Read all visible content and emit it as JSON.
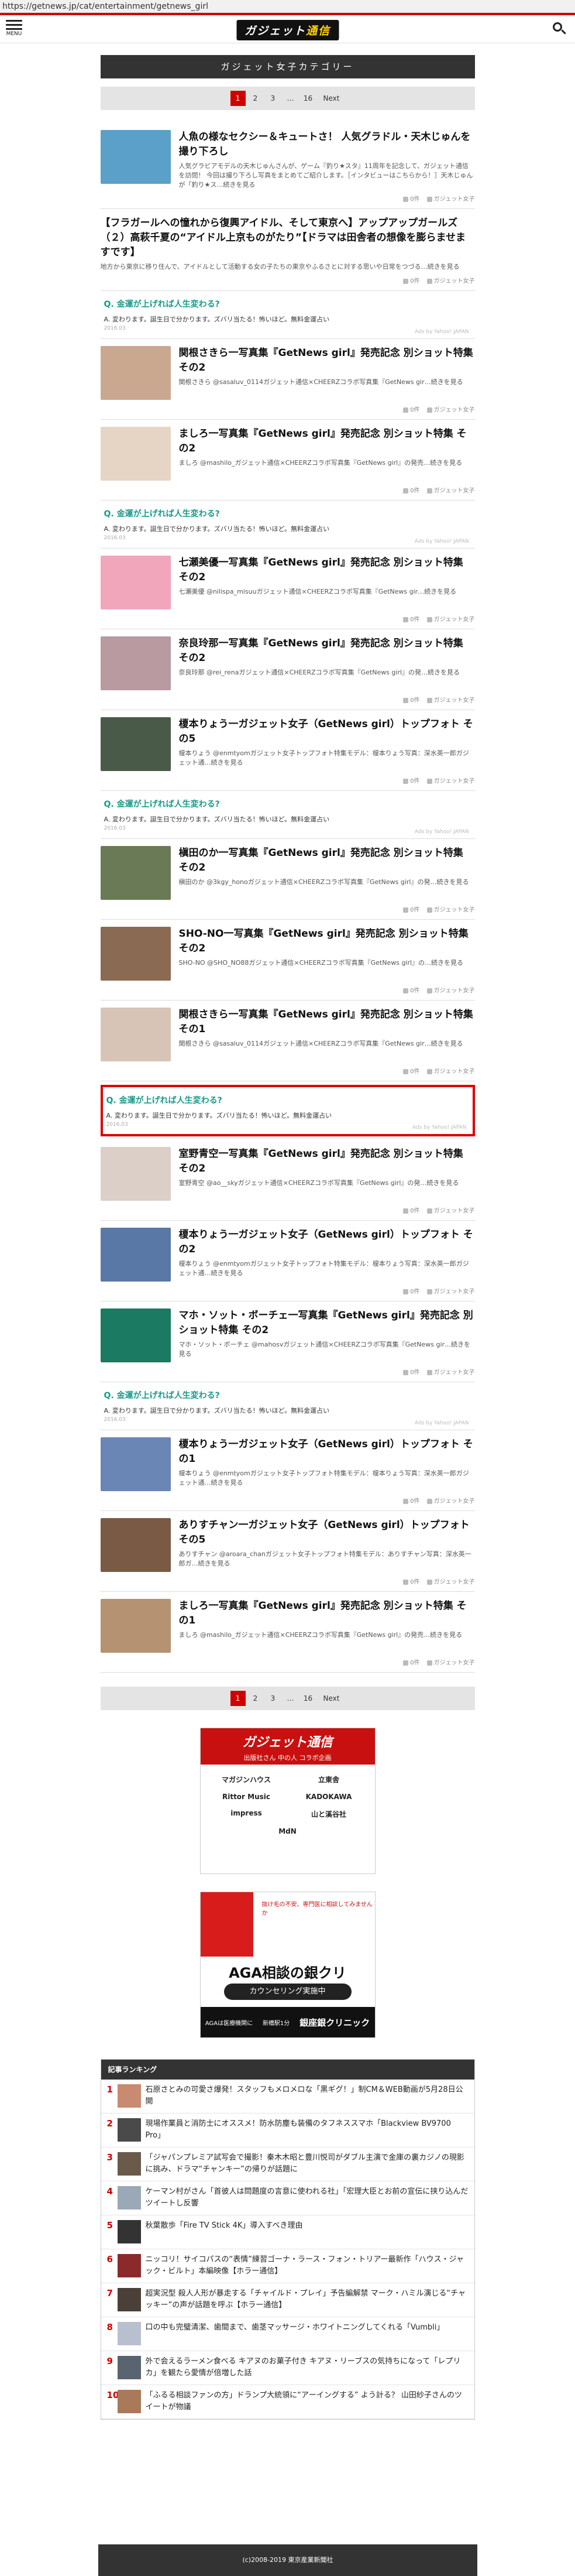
{
  "url": "https://getnews.jp/cat/entertainment/getnews_girl",
  "header": {
    "menu_label": "MENU",
    "logo_a": "ガジェット",
    "logo_b": "通信"
  },
  "category_title": "ガジェット女子カテゴリー",
  "pager": {
    "current": "1",
    "p2": "2",
    "p3": "3",
    "dots": "…",
    "last": "16",
    "next": "Next"
  },
  "ad": {
    "q": "Q. 金運が上げれば人生変わる?",
    "a": "A. 変わります。誕生日で分かります。ズバリ当たる！怖いほど。無料金運占い",
    "date": "2016.03",
    "by": "Ads by Yahoo! JAPAN"
  },
  "meta": {
    "views": "0件",
    "cat": "ガジェット女子"
  },
  "articles": [
    {
      "title": "人魚の様なセクシー＆キュートさ！ 人気グラドル・天木じゅんを撮り下ろし",
      "excerpt": "人気グラビアモデルの天木じゅんさんが、ゲーム『釣り★スタ』11周年を記念して、ガジェット通信を訪問！ 今回は撮り下ろし写真をまとめてご紹介します。［インタビューはこちらから！］天木じゅんが「釣り★ス…続きを見る",
      "c": "#5aa0c8"
    },
    {
      "title": "【フラガールへの憧れから復興アイドル、そして東京へ】アップアップガールズ（２）高萩千夏の“アイドル上京ものがたり”【ドラマは田舎者の想像を膨らませますです】",
      "excerpt": "地方から東京に移り住んで、アイドルとして活動する女の子たちの東京やふるさとに対する思いや日常をつづる…続きを見る",
      "c": ""
    },
    {
      "title": "関根さきら一写真集『GetNews girl』発売記念 別ショット特集 その2",
      "excerpt": "関根さきら @sasaluv_0114ガジェット通信×CHEERZコラボ写真集『GetNews gir…続きを見る",
      "c": "#caa890"
    },
    {
      "title": "ましろ一写真集『GetNews girl』発売記念 別ショット特集 その2",
      "excerpt": "ましろ @mashilo_ガジェット通信×CHEERZコラボ写真集『GetNews girl』の発売…続きを見る",
      "c": "#e6d4c4"
    },
    {
      "title": "七瀬美優一写真集『GetNews girl』発売記念 別ショット特集 その2",
      "excerpt": "七瀬美優 @nilispa_misuuガジェット通信×CHEERZコラボ写真集『GetNews gir…続きを見る",
      "c": "#f2a6bc"
    },
    {
      "title": "奈良玲那一写真集『GetNews girl』発売記念 別ショット特集 その2",
      "excerpt": "奈良玲那 @rei_renaガジェット通信×CHEERZコラボ写真集『GetNews girl』の発…続きを見る",
      "c": "#b89aa0"
    },
    {
      "title": "榎本りょう一ガジェット女子（GetNews girl）トップフォト その5",
      "excerpt": "榎本りょう @enmtyomガジェット女子トップフォト特集モデル：榎本りょう写真：深水英一郎ガジェット通…続きを見る",
      "c": "#4a5a48"
    },
    {
      "title": "槇田のか一写真集『GetNews girl』発売記念 別ショット特集 その2",
      "excerpt": "槇田のか @3kgy_honoガジェット通信×CHEERZコラボ写真集『GetNews girl』の発…続きを見る",
      "c": "#6a7a56"
    },
    {
      "title": "SHO-NO一写真集『GetNews girl』発売記念 別ショット特集 その2",
      "excerpt": "SHO-NO @SHO_NO88ガジェット通信×CHEERZコラボ写真集『GetNews girl』の…続きを見る",
      "c": "#8a6a52"
    },
    {
      "title": "関根さきら一写真集『GetNews girl』発売記念 別ショット特集 その1",
      "excerpt": "関根さきら @sasaluv_0114ガジェット通信×CHEERZコラボ写真集『GetNews gir…続きを見る",
      "c": "#d8c4b6"
    },
    {
      "title": "室野青空一写真集『GetNews girl』発売記念 別ショット特集 その2",
      "excerpt": "室野青空 @ao__skyガジェット通信×CHEERZコラボ写真集『GetNews girl』の発…続きを見る",
      "c": "#dccfc8"
    },
    {
      "title": "榎本りょう一ガジェット女子（GetNews girl）トップフォト その2",
      "excerpt": "榎本りょう @enmtyomガジェット女子トップフォト特集モデル：榎本りょう写真：深水英一郎ガジェット通…続きを見る",
      "c": "#5a78a6"
    },
    {
      "title": "マホ・ソット・ボーチェ一写真集『GetNews girl』発売記念 別ショット特集 その2",
      "excerpt": "マホ・ソット・ボーチェ @mahosvガジェット通信×CHEERZコラボ写真集『GetNews gir…続きを見る",
      "c": "#1a7a62"
    },
    {
      "title": "榎本りょう一ガジェット女子（GetNews girl）トップフォト その1",
      "excerpt": "榎本りょう @enmtyomガジェット女子トップフォト特集モデル：榎本りょう写真：深水英一郎ガジェット通…続きを見る",
      "c": "#6a86b4"
    },
    {
      "title": "ありすチャン一ガジェット女子（GetNews girl）トップフォト その5",
      "excerpt": "ありすチャン @aroara_chanガジェット女子トップフォト特集モデル：ありすチャン写真：深水英一郎ガ…続きを見る",
      "c": "#7a5a44"
    },
    {
      "title": "ましろ一写真集『GetNews girl』発売記念 別ショット特集 その1",
      "excerpt": "ましろ @mashilo_ガジェット通信×CHEERZコラボ写真集『GetNews girl』の発売…続きを見る",
      "c": "#b49272"
    }
  ],
  "banner1": {
    "t1": "ガジェット通信",
    "t2": "出版社さん 中の人 コラボ企画",
    "logos": [
      "マガジンハウス",
      "立東舎",
      "Rittor Music",
      "KADOKAWA",
      "impress",
      "山と溪谷社",
      "MdN"
    ]
  },
  "banner2": {
    "ti": "抜け毛の不安、専門医に相談してみませんか",
    "head": "AGA相談の銀クリ",
    "pill": "カウンセリング実施中",
    "f1": "AGAは医療機関に",
    "f2": "新橋駅1分",
    "f3": "銀座銀クリニック"
  },
  "ranking": {
    "title": "記事ランキング",
    "items": [
      {
        "no": "1",
        "text": "石原さとみの可愛さ爆発！スタッフもメロメロな「黒ギグ！」制CM＆WEB動画が5月28日公開",
        "c": "#c88a70"
      },
      {
        "no": "2",
        "text": "現場作業員と消防士にオススメ！防水防塵も装備のタフネススマホ「Blackview BV9700 Pro」",
        "c": "#4a4a4a"
      },
      {
        "no": "3",
        "text": "「ジャパンプレミア試写会で撮影！秦木木昭と豊川悦司がダブル主演で金庫の裏カジノの現影に挑み、ドラマ“チャンキー”の帰りが話題に",
        "c": "#6a5a4a"
      },
      {
        "no": "4",
        "text": "ケーマン村がさん「首彼人は問題度の言意に使われる社」「宏理大臣とお前の宣伝に挟り込んだツイートし反響",
        "c": "#9aa8b8"
      },
      {
        "no": "5",
        "text": "秋葉散歩「Fire TV Stick 4K」導入すべき理由",
        "c": "#333333"
      },
      {
        "no": "6",
        "text": "ニッコリ！サイコパスの“表情”練習ゴーナ・ラース・フォン・トリアー最新作「ハウス・ジャック・ビルト」本編映像【ホラー通信】",
        "c": "#8a2a2a"
      },
      {
        "no": "7",
        "text": "超実況型 殺人人形が暴走する「チャイルド・プレイ」予告編解禁 マーク・ハミル演じる“チャッキー”の声が話題を呼ぶ【ホラー通信】",
        "c": "#4a4038"
      },
      {
        "no": "8",
        "text": "口の中も完璧清潔、歯間まで、歯茎マッサージ・ホワイトニングしてくれる「Vumbli」",
        "c": "#b8c0d0"
      },
      {
        "no": "9",
        "text": "外で会えるラーメン食べる キアヌのお菓子付き キアヌ・リーブスの気持ちになって「レプリカ」を観たら愛情が倍増した話",
        "c": "#5a6470"
      },
      {
        "no": "10",
        "text": "「ふるる相談ファンの方」ドランプ大統領に“アーイングする” よう計る？ 山田紗子さんのツイートが物議",
        "c": "#a87a5a"
      }
    ]
  },
  "footer": "(c)2008-2019 東京産業新聞社"
}
